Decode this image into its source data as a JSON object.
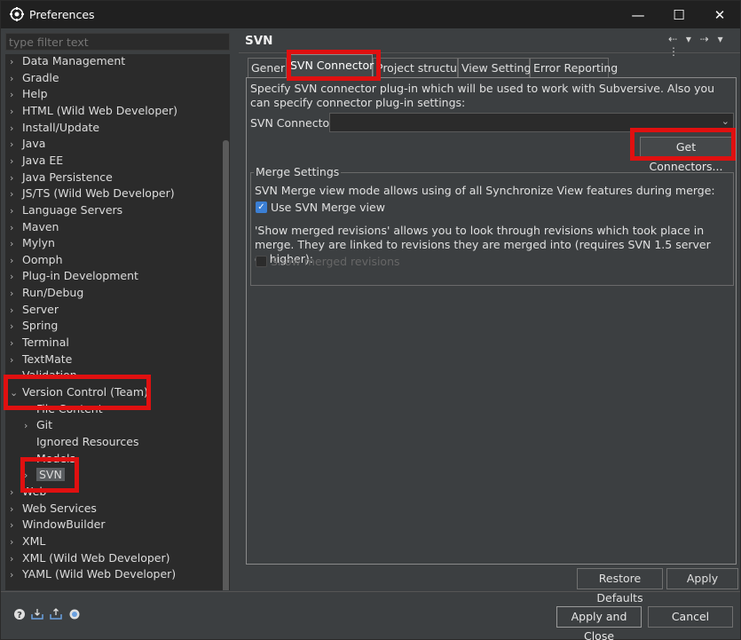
{
  "window": {
    "title": "Preferences",
    "minimize_glyph": "—",
    "maximize_glyph": "☐",
    "close_glyph": "✕"
  },
  "filter": {
    "placeholder": "type filter text"
  },
  "tree": {
    "items": [
      {
        "label": "Data Management",
        "expander": "›"
      },
      {
        "label": "Gradle",
        "expander": "›"
      },
      {
        "label": "Help",
        "expander": "›"
      },
      {
        "label": "HTML (Wild Web Developer)",
        "expander": "›"
      },
      {
        "label": "Install/Update",
        "expander": "›"
      },
      {
        "label": "Java",
        "expander": "›"
      },
      {
        "label": "Java EE",
        "expander": "›"
      },
      {
        "label": "Java Persistence",
        "expander": "›"
      },
      {
        "label": "JS/TS (Wild Web Developer)",
        "expander": "›"
      },
      {
        "label": "Language Servers",
        "expander": "›"
      },
      {
        "label": "Maven",
        "expander": "›"
      },
      {
        "label": "Mylyn",
        "expander": "›"
      },
      {
        "label": "Oomph",
        "expander": "›"
      },
      {
        "label": "Plug-in Development",
        "expander": "›"
      },
      {
        "label": "Run/Debug",
        "expander": "›"
      },
      {
        "label": "Server",
        "expander": "›"
      },
      {
        "label": "Spring",
        "expander": "›"
      },
      {
        "label": "Terminal",
        "expander": "›"
      },
      {
        "label": "TextMate",
        "expander": "›"
      },
      {
        "label": "Validation",
        "expander": ""
      },
      {
        "label": "Version Control (Team)",
        "expander": "⌄"
      },
      {
        "label": "File Content",
        "expander": ""
      },
      {
        "label": "Git",
        "expander": "›"
      },
      {
        "label": "Ignored Resources",
        "expander": ""
      },
      {
        "label": "Models",
        "expander": ""
      },
      {
        "label": "SVN",
        "expander": "›"
      },
      {
        "label": "Web",
        "expander": "›"
      },
      {
        "label": "Web Services",
        "expander": "›"
      },
      {
        "label": "WindowBuilder",
        "expander": "›"
      },
      {
        "label": "XML",
        "expander": "›"
      },
      {
        "label": "XML (Wild Web Developer)",
        "expander": "›"
      },
      {
        "label": "YAML (Wild Web Developer)",
        "expander": "›"
      }
    ],
    "selected": "SVN"
  },
  "page": {
    "title": "SVN",
    "nav_back": "⇠ ▾",
    "nav_forward": "⇢ ▾",
    "menu": "⋮"
  },
  "tabs": [
    {
      "label": "General"
    },
    {
      "label": "SVN Connector"
    },
    {
      "label": "Project structure"
    },
    {
      "label": "View Settings"
    },
    {
      "label": "Error Reporting"
    }
  ],
  "active_tab": "SVN Connector",
  "connector": {
    "description": "Specify SVN connector plug-in which will be used to work with Subversive. Also you can specify connector plug-in settings:",
    "label": "SVN Connector:",
    "value": "",
    "get_connectors_label": "Get Connectors..."
  },
  "merge": {
    "legend": "Merge Settings",
    "description": "SVN Merge view mode allows using of all Synchronize View features during merge:",
    "use_merge_view_label": "Use SVN Merge view",
    "use_merge_view_checked": true,
    "merged_revisions_description": "'Show merged revisions' allows you to look through revisions which took place in merge. They are linked to revisions they are merged into (requires SVN 1.5 server or higher):",
    "show_merged_label": "Show merged revisions",
    "show_merged_checked": false,
    "show_merged_enabled": false
  },
  "buttons": {
    "restore_defaults": "Restore Defaults",
    "apply": "Apply",
    "apply_and_close": "Apply and Close",
    "cancel": "Cancel"
  },
  "bottom_icons": [
    "help-icon",
    "import-icon",
    "export-icon",
    "record-icon"
  ],
  "colors": {
    "background": "#3c3f41",
    "tree_background": "#2b2b2b",
    "highlight_red": "#e01010",
    "checkbox_blue": "#3b7fd4"
  }
}
